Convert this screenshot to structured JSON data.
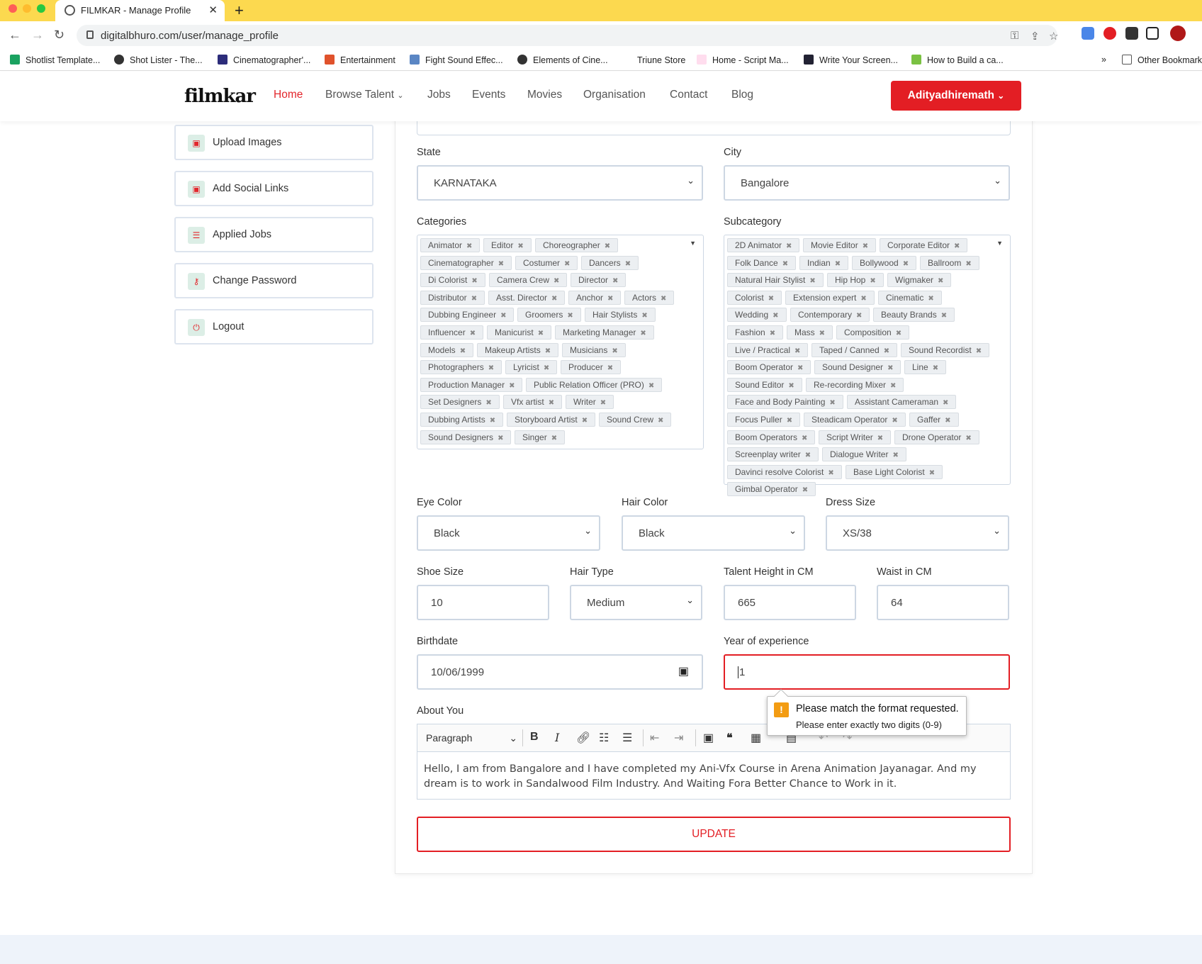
{
  "browser": {
    "tab_title": "FILMKAR - Manage Profile",
    "url": "digitalbhuro.com/user/manage_profile",
    "bookmarks": [
      {
        "label": "Shotlist Template..."
      },
      {
        "label": "Shot Lister - The..."
      },
      {
        "label": "Cinematographer'..."
      },
      {
        "label": "Entertainment"
      },
      {
        "label": "Fight Sound Effec..."
      },
      {
        "label": "Elements of Cine..."
      },
      {
        "label": "Triune Store"
      },
      {
        "label": "Home - Script Ma..."
      },
      {
        "label": "Write Your Screen..."
      },
      {
        "label": "How to Build a ca..."
      }
    ],
    "more_bookmarks": "»",
    "other_bookmarks": "Other Bookmarks"
  },
  "site": {
    "logo": "filmkar",
    "nav": [
      "Home",
      "Browse Talent",
      "Jobs",
      "Events",
      "Movies",
      "Organisation",
      "Contact",
      "Blog"
    ],
    "user_button": "Adityadhiremath"
  },
  "sidebar": {
    "items": [
      {
        "label": "Upload Images"
      },
      {
        "label": "Add Social Links"
      },
      {
        "label": "Applied Jobs"
      },
      {
        "label": "Change Password"
      },
      {
        "label": "Logout"
      }
    ]
  },
  "form": {
    "state_label": "State",
    "state_value": "KARNATAKA",
    "city_label": "City",
    "city_value": "Bangalore",
    "categories_label": "Categories",
    "categories": [
      "Animator",
      "Editor",
      "Choreographer",
      "Cinematographer",
      "Costumer",
      "Dancers",
      "Di Colorist",
      "Camera Crew",
      "Director",
      "Distributor",
      "Asst. Director",
      "Anchor",
      "Actors",
      "Dubbing Engineer",
      "Groomers",
      "Hair Stylists",
      "Influencer",
      "Manicurist",
      "Marketing Manager",
      "Models",
      "Makeup Artists",
      "Musicians",
      "Photographers",
      "Lyricist",
      "Producer",
      "Production Manager",
      "Public Relation Officer (PRO)",
      "Set Designers",
      "Vfx artist",
      "Writer",
      "Dubbing Artists",
      "Storyboard Artist",
      "Sound Crew",
      "Sound Designers",
      "Singer"
    ],
    "subcategory_label": "Subcategory",
    "subcategories": [
      "2D Animator",
      "Movie Editor",
      "Corporate Editor",
      "Folk Dance",
      "Indian",
      "Bollywood",
      "Ballroom",
      "Natural Hair Stylist",
      "Hip Hop",
      "Wigmaker",
      "Colorist",
      "Extension expert",
      "Cinematic",
      "Wedding",
      "Contemporary",
      "Beauty Brands",
      "Fashion",
      "Mass",
      "Composition",
      "Live / Practical",
      "Taped / Canned",
      "Sound Recordist",
      "Boom Operator",
      "Sound Designer",
      "Line",
      "Sound Editor",
      "Re-recording Mixer",
      "Face and Body Painting",
      "Assistant Cameraman",
      "Focus Puller",
      "Steadicam Operator",
      "Gaffer",
      "Boom Operators",
      "Script Writer",
      "Drone Operator",
      "Screenplay writer",
      "Dialogue Writer",
      "Davinci resolve Colorist",
      "Base Light Colorist",
      "Gimbal Operator"
    ],
    "eye_color_label": "Eye Color",
    "eye_color_value": "Black",
    "hair_color_label": "Hair Color",
    "hair_color_value": "Black",
    "dress_size_label": "Dress Size",
    "dress_size_value": "XS/38",
    "shoe_size_label": "Shoe Size",
    "shoe_size_value": "10",
    "hair_type_label": "Hair Type",
    "hair_type_value": "Medium",
    "height_label": "Talent Height in CM",
    "height_value": "665",
    "waist_label": "Waist in CM",
    "waist_value": "64",
    "birthdate_label": "Birthdate",
    "birthdate_value": "10/06/1999",
    "experience_label": "Year of experience",
    "experience_value": "1",
    "about_label": "About You",
    "editor_format": "Paragraph",
    "about_text": "Hello, I am from Bangalore and I have completed my Ani-Vfx Course in Arena Animation Jayanagar. And my dream is to work in Sandalwood Film Industry. And Waiting Fora Better Chance to Work in it.",
    "update_button": "UPDATE"
  },
  "tooltip": {
    "title": "Please match the format requested.",
    "message": "Please enter exactly two digits (0-9)"
  },
  "colors": {
    "brand": "#e31e24",
    "chrome_yellow": "#fcd94f"
  }
}
